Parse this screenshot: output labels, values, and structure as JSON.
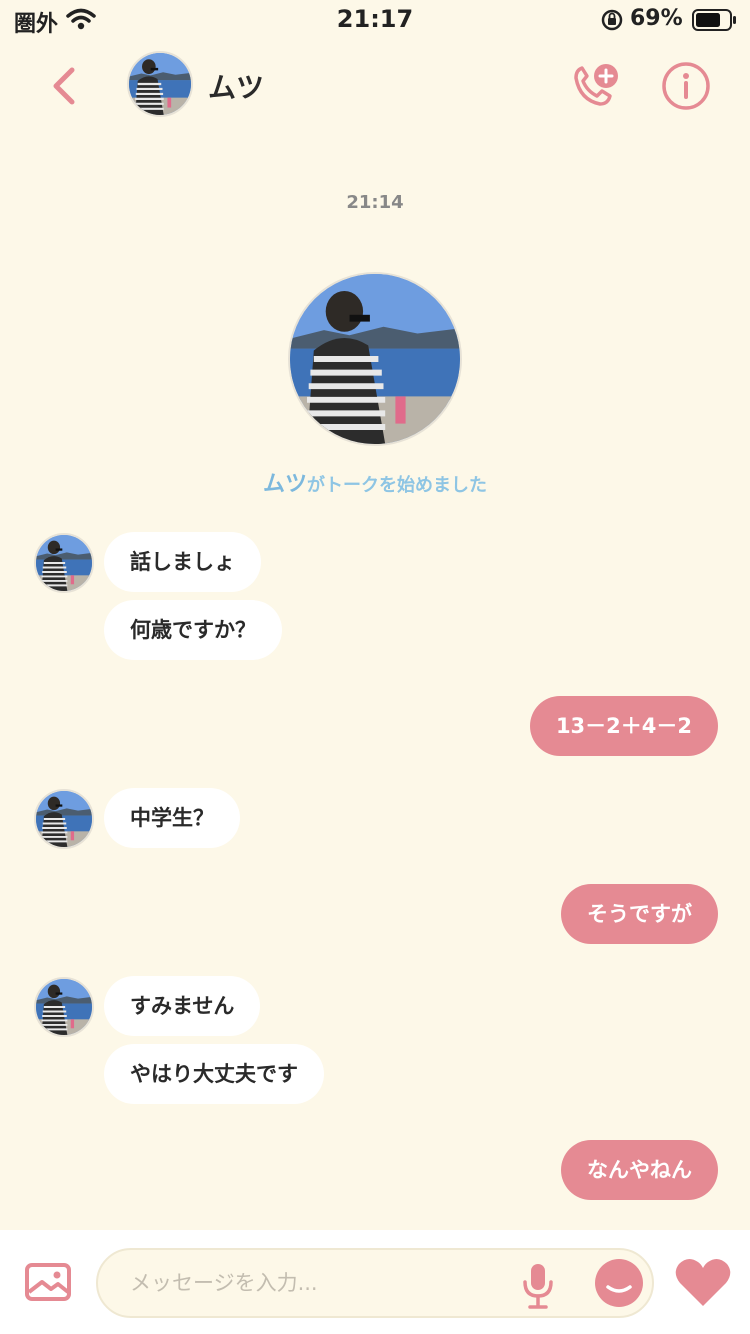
{
  "status_bar": {
    "carrier": "圏外",
    "time": "21:17",
    "battery": "69%"
  },
  "header": {
    "name": "ムツ"
  },
  "conversation": {
    "timestamp": "21:14",
    "start_notice_name": "ムツ",
    "start_notice_text": "がトークを始めました"
  },
  "messages": [
    {
      "side": "in",
      "text": "話しましょ"
    },
    {
      "side": "in",
      "text": "何歳ですか？"
    },
    {
      "side": "out",
      "text": "13－2＋4－2"
    },
    {
      "side": "in",
      "text": "中学生？"
    },
    {
      "side": "out",
      "text": "そうですが"
    },
    {
      "side": "in",
      "text": "すみません"
    },
    {
      "side": "in",
      "text": "やはり大丈夫です"
    },
    {
      "side": "out",
      "text": "なんやねん"
    }
  ],
  "input": {
    "placeholder": "メッセージを入力..."
  },
  "icons": {
    "back": "chevron-left-icon",
    "call": "phone-add-icon",
    "info": "info-icon",
    "image": "image-icon",
    "mic": "microphone-icon",
    "emoji": "smile-icon",
    "like": "heart-icon"
  },
  "colors": {
    "accent": "#e58a93",
    "background": "#fdf8e8",
    "notice": "#8ec5e4"
  }
}
